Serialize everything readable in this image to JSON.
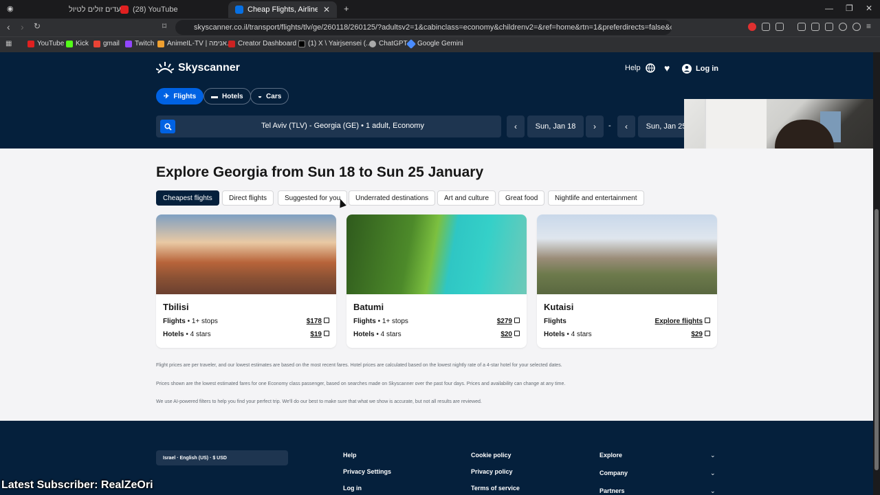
{
  "browser": {
    "tabs": [
      {
        "label": "יעדים זולים לטיול"
      },
      {
        "label": "(28) YouTube"
      },
      {
        "label": "Cheap Flights, Airline Tickets & A"
      }
    ],
    "url": "skyscanner.co.il/transport/flights/tlv/ge/260118/260125/?adultsv2=1&cabinclass=economy&childrenv2=&ref=home&rtn=1&preferdirects=false&o...",
    "bookmarks": [
      "YouTube",
      "Kick",
      "gmail",
      "Twitch",
      "AnimeIL-TV | אנימה...",
      "Creator Dashboard |...",
      "(1) X \\ Yairjsensei (...",
      "ChatGPT",
      "Google Gemini"
    ]
  },
  "header": {
    "brand": "Skyscanner",
    "help": "Help",
    "login": "Log in",
    "modes": [
      {
        "label": "Flights",
        "icon": "plane-icon"
      },
      {
        "label": "Hotels",
        "icon": "bed-icon"
      },
      {
        "label": "Cars",
        "icon": "car-icon"
      }
    ],
    "search_summary": "Tel Aviv (TLV) - Georgia (GE)  •  1 adult, Economy",
    "depart_date": "Sun, Jan 18",
    "return_date": "Sun, Jan 25",
    "date_sep": "-"
  },
  "main": {
    "title": "Explore Georgia from Sun 18 to Sun 25 January",
    "filters": [
      "Cheapest flights",
      "Direct flights",
      "Suggested for you",
      "Underrated destinations",
      "Art and culture",
      "Great food",
      "Nightlife and entertainment"
    ],
    "cards": [
      {
        "city": "Tbilisi",
        "flights_label": "Flights",
        "flights_detail": "• 1+ stops",
        "flights_price": "$178",
        "hotels_label": "Hotels",
        "hotels_detail": "• 4 stars",
        "hotels_price": "$19"
      },
      {
        "city": "Batumi",
        "flights_label": "Flights",
        "flights_detail": "• 1+ stops",
        "flights_price": "$279",
        "hotels_label": "Hotels",
        "hotels_detail": "• 4 stars",
        "hotels_price": "$20"
      },
      {
        "city": "Kutaisi",
        "flights_label": "Flights",
        "flights_detail": "",
        "flights_price": "Explore flights",
        "hotels_label": "Hotels",
        "hotels_detail": "• 4 stars",
        "hotels_price": "$29"
      }
    ],
    "notes": [
      "Flight prices are per traveler, and our lowest estimates are based on the most recent fares. Hotel prices are calculated based on the lowest nightly rate of a 4-star hotel for your selected dates.",
      "Prices shown are the lowest estimated fares for one Economy class passenger, based on searches made on Skyscanner over the past four days. Prices and availability can change at any time.",
      "We use AI-powered filters to help you find your perfect trip. We'll do our best to make sure that what we show is accurate, but not all results are reviewed."
    ]
  },
  "footer": {
    "locale": "Israel · English (US) · $ USD",
    "col1": [
      "Help",
      "Privacy Settings",
      "Log in"
    ],
    "col2": [
      "Cookie policy",
      "Privacy policy",
      "Terms of service"
    ],
    "col3": [
      "Explore",
      "Company",
      "Partners"
    ]
  },
  "overlay_text": "Latest Subscriber: RealZeOri",
  "colors": {
    "navy": "#05203c",
    "blue": "#0062e3"
  }
}
